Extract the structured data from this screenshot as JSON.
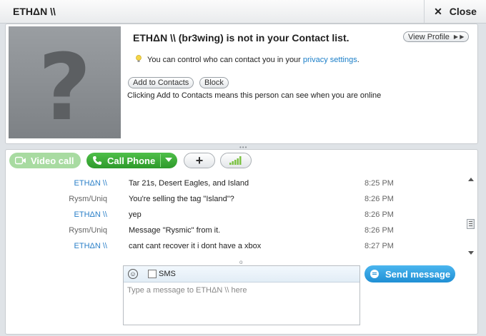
{
  "window": {
    "title": "ETHΔN \\\\",
    "close_label": "Close"
  },
  "contact_notice": {
    "headline": "ETHΔN \\\\ (br3wing) is not in your Contact list.",
    "view_profile_label": "View Profile",
    "privacy_prefix": "You can control who can contact you in your ",
    "privacy_link": "privacy settings",
    "privacy_suffix": ".",
    "add_contact_label": "Add to Contacts",
    "block_label": "Block",
    "note": "Clicking Add to Contacts means this person can see when you are online",
    "avatar_placeholder": "?"
  },
  "toolbar": {
    "video_call_label": "Video call",
    "call_phone_label": "Call Phone",
    "add_label": "+"
  },
  "messages": [
    {
      "sender": "ETHΔN \\\\",
      "text": "Tar 21s, Desert Eagles, and Island",
      "time": "8:25 PM",
      "self": true
    },
    {
      "sender": "Rysm/Uniq",
      "text": "You're selling the tag \"Island\"?",
      "time": "8:26 PM",
      "self": false
    },
    {
      "sender": "ETHΔN \\\\",
      "text": "yep",
      "time": "8:26 PM",
      "self": true
    },
    {
      "sender": "Rysm/Uniq",
      "text": "Message \"Rysmic\" from it.",
      "time": "8:26 PM",
      "self": false
    },
    {
      "sender": "ETHΔN \\\\",
      "text": "cant cant recover it i dont have a xbox",
      "time": "8:27 PM",
      "self": true
    }
  ],
  "composer": {
    "sms_label": "SMS",
    "placeholder": "Type a message to ETHΔN \\\\ here",
    "send_label": "Send message"
  },
  "colors": {
    "link": "#1a7ec8",
    "call_green": "#3aad35",
    "send_blue": "#2b9be0"
  }
}
